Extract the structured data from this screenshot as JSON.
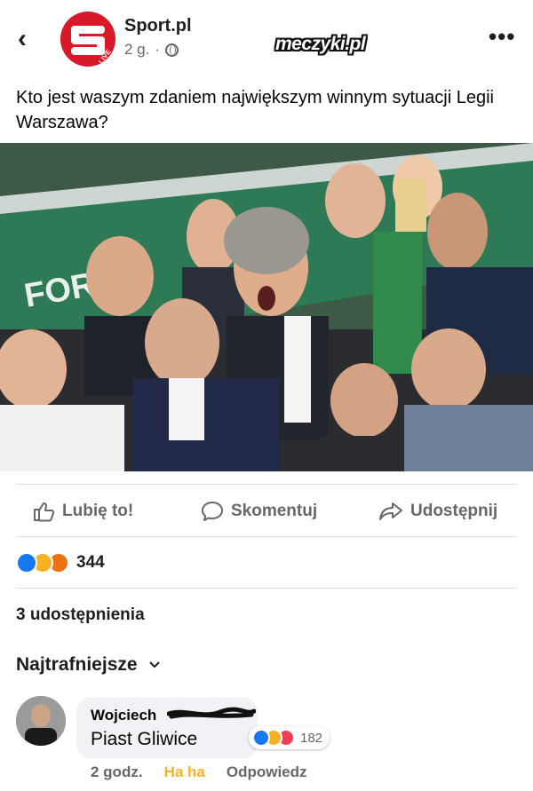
{
  "header": {
    "page_name": "Sport.pl",
    "time": "2 g.",
    "separator": "·",
    "logo_badge": "LIVE",
    "watermark": "meczyki.pl",
    "more_label": "•••"
  },
  "post": {
    "text": "Kto jest waszym zdaniem największym winnym sytuacji Legii Warszawa?",
    "photo_sign_text": "FOR"
  },
  "actions": {
    "like": "Lubię to!",
    "comment": "Skomentuj",
    "share": "Udostępnij"
  },
  "reactions": {
    "types": [
      "like",
      "haha",
      "angry"
    ],
    "count": "344"
  },
  "shares_label": "3 udostępnienia",
  "comments_sort": "Najtrafniejsze",
  "comment": {
    "author": "Wojciech",
    "text": "Piast Gliwice",
    "reaction_types": [
      "like",
      "haha",
      "love"
    ],
    "reaction_count": "182",
    "time": "2 godz.",
    "haha_label": "Ha ha",
    "reply_label": "Odpowiedz"
  },
  "colors": {
    "facebook_blue": "#1877f2",
    "sport_red": "#d7192a",
    "meta_gray": "#65676b",
    "haha_yellow": "#f7b125"
  }
}
